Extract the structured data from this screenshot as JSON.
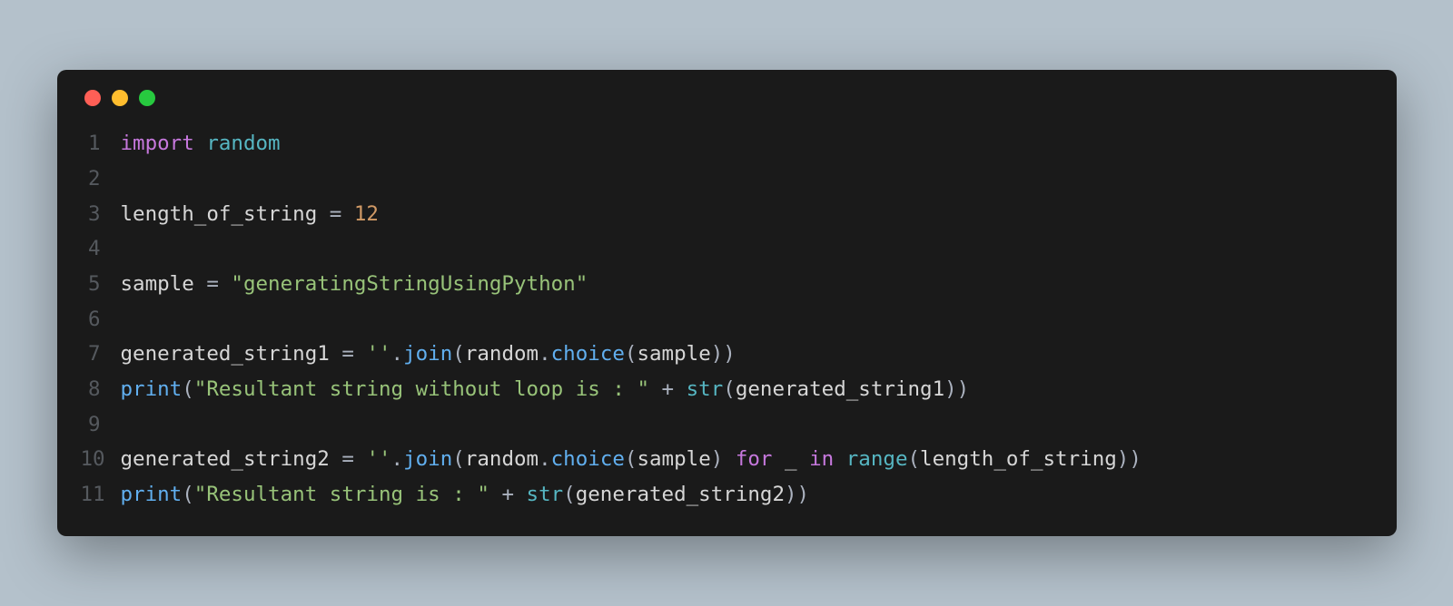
{
  "window": {
    "buttons": {
      "close": "close",
      "minimize": "minimize",
      "zoom": "zoom"
    }
  },
  "code": {
    "line_numbers": [
      "1",
      "2",
      "3",
      "4",
      "5",
      "6",
      "7",
      "8",
      "9",
      "10",
      "11"
    ],
    "l1": {
      "a": "import",
      "b": " ",
      "c": "random"
    },
    "l2": "",
    "l3": {
      "a": "length_of_string",
      "b": " ",
      "c": "=",
      "d": " ",
      "e": "12"
    },
    "l4": "",
    "l5": {
      "a": "sample",
      "b": " ",
      "c": "=",
      "d": " ",
      "e": "\"generatingStringUsingPython\""
    },
    "l6": "",
    "l7": {
      "a": "generated_string1",
      "b": " ",
      "c": "=",
      "d": " ",
      "e": "''",
      "f": ".",
      "g": "join",
      "h": "(",
      "i": "random",
      "j": ".",
      "k": "choice",
      "l": "(",
      "m": "sample",
      "n": "))"
    },
    "l8": {
      "a": "print",
      "b": "(",
      "c": "\"Resultant string without loop is : \"",
      "d": " ",
      "e": "+",
      "f": " ",
      "g": "str",
      "h": "(",
      "i": "generated_string1",
      "j": "))"
    },
    "l9": "",
    "l10": {
      "a": "generated_string2",
      "b": " ",
      "c": "=",
      "d": " ",
      "e": "''",
      "f": ".",
      "g": "join",
      "h": "(",
      "i": "random",
      "j": ".",
      "k": "choice",
      "l": "(",
      "m": "sample",
      "n": ")",
      "o": " ",
      "p": "for",
      "q": " ",
      "r": "_",
      "s": " ",
      "t": "in",
      "u": " ",
      "v": "range",
      "w": "(",
      "x": "length_of_string",
      "y": "))"
    },
    "l11": {
      "a": "print",
      "b": "(",
      "c": "\"Resultant string is : \"",
      "d": " ",
      "e": "+",
      "f": " ",
      "g": "str",
      "h": "(",
      "i": "generated_string2",
      "j": "))"
    }
  }
}
